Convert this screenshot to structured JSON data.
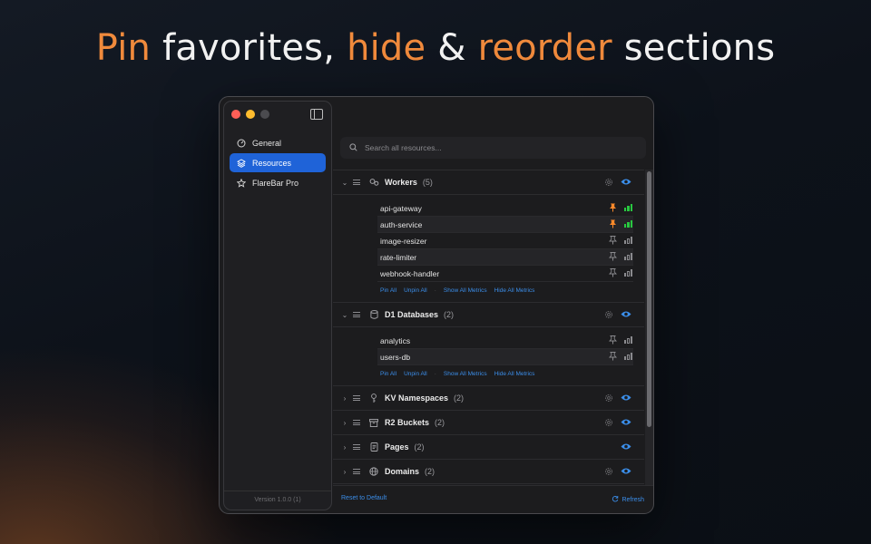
{
  "headline": {
    "pin": "Pin",
    "favorites": " favorites, ",
    "hide": "hide",
    "amp": " & ",
    "reorder": "reorder",
    "sections": " sections"
  },
  "sidebar": {
    "items": [
      {
        "label": "General",
        "icon": "gauge-icon"
      },
      {
        "label": "Resources",
        "icon": "layers-icon",
        "active": true
      },
      {
        "label": "FlareBar Pro",
        "icon": "star-icon"
      }
    ],
    "version": "Version 1.0.0 (1)"
  },
  "search": {
    "placeholder": "Search all resources..."
  },
  "sections": {
    "workers": {
      "title": "Workers",
      "count": "(5)",
      "items": [
        "api-gateway",
        "auth-service",
        "image-resizer",
        "rate-limiter",
        "webhook-handler"
      ],
      "pinned": [
        true,
        true,
        false,
        false,
        false
      ]
    },
    "d1": {
      "title": "D1 Databases",
      "count": "(2)",
      "items": [
        "analytics",
        "users-db"
      ]
    },
    "kv": {
      "title": "KV Namespaces",
      "count": "(2)"
    },
    "r2": {
      "title": "R2 Buckets",
      "count": "(2)"
    },
    "pages": {
      "title": "Pages",
      "count": "(2)"
    },
    "domains": {
      "title": "Domains",
      "count": "(2)"
    }
  },
  "actions": {
    "pin_all": "Pin All",
    "unpin_all": "Unpin All",
    "separator": "·",
    "show_all_metrics": "Show All Metrics",
    "hide_all_metrics": "Hide All Metrics"
  },
  "footer": {
    "reset": "Reset to Default",
    "refresh": "Refresh"
  },
  "colors": {
    "accent_orange": "#f08a3c",
    "link_blue": "#3b8eea",
    "active_blue": "#1f63d8",
    "pinned_orange": "#ff8a2a",
    "metric_green": "#28c840"
  }
}
